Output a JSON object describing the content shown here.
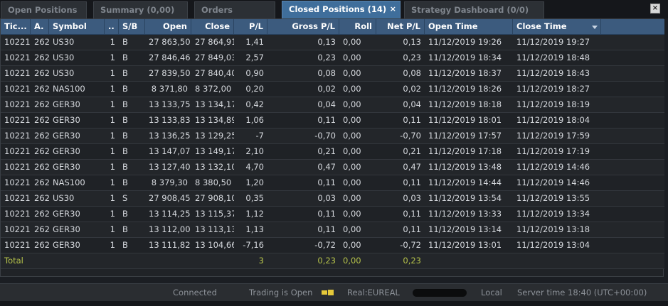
{
  "tabs": [
    {
      "label": "Open Positions"
    },
    {
      "label": "Summary (0,00)"
    },
    {
      "label": "Orders"
    },
    {
      "label": "Closed Positions (14)",
      "close": "×"
    },
    {
      "label": "Strategy Dashboard (0/0)"
    }
  ],
  "window_close": "×",
  "columns": [
    "Tic...",
    "A.",
    "Symbol",
    "..",
    "S/B",
    "Open",
    "Close",
    "P/L",
    "Gross P/L",
    "Roll",
    "Net P/L",
    "Open Time",
    "Close Time"
  ],
  "rows": [
    [
      "10221",
      "262",
      "US30",
      "1",
      "B",
      "27 863,50",
      "27 864,91",
      "1,41",
      "0,13",
      "0,00",
      "0,13",
      "11/12/2019 19:26",
      "11/12/2019 19:27"
    ],
    [
      "10221",
      "262",
      "US30",
      "1",
      "B",
      "27 846,46",
      "27 849,03",
      "2,57",
      "0,23",
      "0,00",
      "0,23",
      "11/12/2019 18:34",
      "11/12/2019 18:48"
    ],
    [
      "10221",
      "262",
      "US30",
      "1",
      "B",
      "27 839,50",
      "27 840,40",
      "0,90",
      "0,08",
      "0,00",
      "0,08",
      "11/12/2019 18:37",
      "11/12/2019 18:43"
    ],
    [
      "10221",
      "262",
      "NAS100",
      "1",
      "B",
      "8 371,80",
      "8 372,00",
      "0,20",
      "0,02",
      "0,00",
      "0,02",
      "11/12/2019 18:26",
      "11/12/2019 18:27"
    ],
    [
      "10221",
      "262",
      "GER30",
      "1",
      "B",
      "13 133,75",
      "13 134,17",
      "0,42",
      "0,04",
      "0,00",
      "0,04",
      "11/12/2019 18:18",
      "11/12/2019 18:19"
    ],
    [
      "10221",
      "262",
      "GER30",
      "1",
      "B",
      "13 133,83",
      "13 134,89",
      "1,06",
      "0,11",
      "0,00",
      "0,11",
      "11/12/2019 18:01",
      "11/12/2019 18:04"
    ],
    [
      "10221",
      "262",
      "GER30",
      "1",
      "B",
      "13 136,25",
      "13 129,25",
      "-7",
      "-0,70",
      "0,00",
      "-0,70",
      "11/12/2019 17:57",
      "11/12/2019 17:59"
    ],
    [
      "10221",
      "262",
      "GER30",
      "1",
      "B",
      "13 147,07",
      "13 149,17",
      "2,10",
      "0,21",
      "0,00",
      "0,21",
      "11/12/2019 17:18",
      "11/12/2019 17:19"
    ],
    [
      "10221",
      "262",
      "GER30",
      "1",
      "B",
      "13 127,40",
      "13 132,10",
      "4,70",
      "0,47",
      "0,00",
      "0,47",
      "11/12/2019 13:48",
      "11/12/2019 14:46"
    ],
    [
      "10221",
      "262",
      "NAS100",
      "1",
      "B",
      "8 379,30",
      "8 380,50",
      "1,20",
      "0,11",
      "0,00",
      "0,11",
      "11/12/2019 14:44",
      "11/12/2019 14:46"
    ],
    [
      "10221",
      "262",
      "US30",
      "1",
      "S",
      "27 908,45",
      "27 908,10",
      "0,35",
      "0,03",
      "0,00",
      "0,03",
      "11/12/2019 13:54",
      "11/12/2019 13:55"
    ],
    [
      "10221",
      "262",
      "GER30",
      "1",
      "B",
      "13 114,25",
      "13 115,37",
      "1,12",
      "0,11",
      "0,00",
      "0,11",
      "11/12/2019 13:33",
      "11/12/2019 13:34"
    ],
    [
      "10221",
      "262",
      "GER30",
      "1",
      "B",
      "13 112,00",
      "13 113,13",
      "1,13",
      "0,11",
      "0,00",
      "0,11",
      "11/12/2019 13:14",
      "11/12/2019 13:18"
    ],
    [
      "10221",
      "262",
      "GER30",
      "1",
      "B",
      "13 111,82",
      "13 104,66",
      "-7,16",
      "-0,72",
      "0,00",
      "-0,72",
      "11/12/2019 13:01",
      "11/12/2019 13:04"
    ]
  ],
  "total": {
    "label": "Total",
    "pl": "3",
    "gross_pl": "0,23",
    "roll": "0,00",
    "net_pl": "0,23"
  },
  "status": {
    "connection": "Connected",
    "trading": "Trading is Open",
    "account": "Real:EUREAL",
    "timezone_mode": "Local",
    "server_time": "Server time 18:40 (UTC+00:00)"
  },
  "colors": {
    "accent_tab": "#3f6e9b",
    "header": "#3c5b7e",
    "total_text": "#b5c24a",
    "status_icon": "#e6c93a"
  },
  "icons": {
    "tab_close": "close-icon",
    "window_close": "close-icon",
    "status": "plug-icon"
  }
}
